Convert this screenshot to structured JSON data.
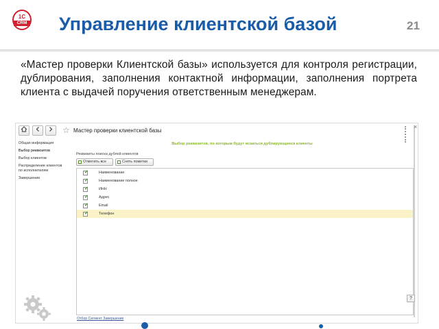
{
  "slide": {
    "logo_top": "1С",
    "logo_bottom": "CRM",
    "title": "Управление клиентской базой",
    "page_number": "21",
    "intro": "«Мастер проверки Клиентской базы» используется для контроля регистрации, дублирования, заполнения контактной информации, заполнения портрета клиента с выдачей поручения ответственным менеджерам."
  },
  "window": {
    "title": "Мастер проверки клиентской базы",
    "home_icon": "home-icon",
    "back_icon": "arrow-left-icon",
    "forward_icon": "arrow-right-icon",
    "star_icon": "star-icon",
    "close_glyph": "×",
    "help_label": "?"
  },
  "sidebar": {
    "items": [
      {
        "label": "Общая информация",
        "active": false
      },
      {
        "label": "Выбор реквизитов",
        "active": true
      },
      {
        "label": "Выбор клиентов",
        "active": false
      },
      {
        "label": "Распределение клиентов",
        "active": false
      },
      {
        "label": "по исполнителям",
        "active": false
      },
      {
        "label": "Завершение",
        "active": false
      }
    ]
  },
  "main": {
    "step_heading": "Выбор реквизитов, по которым будут искаться дублирующиеся клиенты",
    "requisites_label": "Реквизиты поиска дублей клиентов",
    "buttons": {
      "check_all": "Отметить все",
      "uncheck_all": "Снять пометки"
    },
    "rows": [
      {
        "label": "Наименование",
        "checked": true,
        "selected": false
      },
      {
        "label": "Наименование полное",
        "checked": true,
        "selected": false
      },
      {
        "label": "ИНН",
        "checked": true,
        "selected": false
      },
      {
        "label": "Адрес",
        "checked": true,
        "selected": false
      },
      {
        "label": "Email",
        "checked": true,
        "selected": false
      },
      {
        "label": "Телефон",
        "checked": true,
        "selected": true
      }
    ],
    "bottom_nav": "Отбор  Сегмент  Завершение"
  },
  "colors": {
    "title_blue": "#1a5ca8",
    "step_green": "#8cb82a",
    "selected_row": "#fbf3c8",
    "logo_red": "#d02030"
  }
}
